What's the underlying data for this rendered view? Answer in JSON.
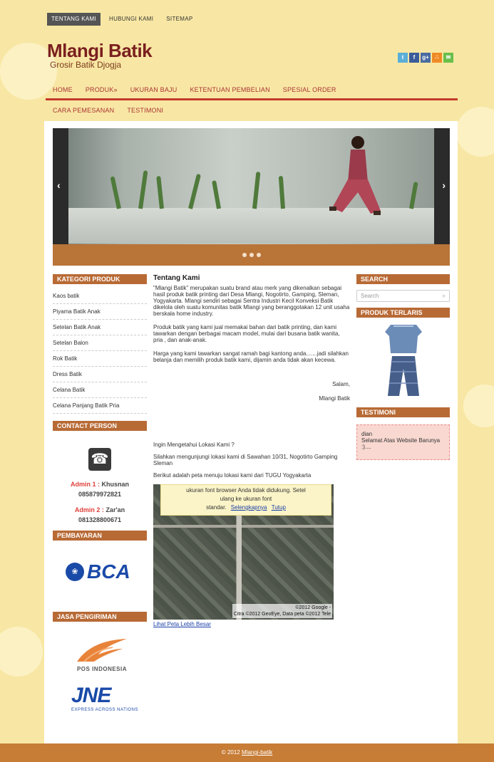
{
  "top_nav": [
    {
      "label": "TENTANG KAMI",
      "active": true
    },
    {
      "label": "HUBUNGI KAMI",
      "active": false
    },
    {
      "label": "SITEMAP",
      "active": false
    }
  ],
  "brand": {
    "title": "Mlangi Batik",
    "tagline": "Grosir Batik Djogja"
  },
  "social_icons": [
    {
      "name": "twitter-icon",
      "glyph": "t",
      "color": "#5aaed8"
    },
    {
      "name": "facebook-icon",
      "glyph": "f",
      "color": "#3b5b9a"
    },
    {
      "name": "googleplus-icon",
      "glyph": "g+",
      "color": "#4a6aa0"
    },
    {
      "name": "rss-icon",
      "glyph": "∴",
      "color": "#f08a24"
    },
    {
      "name": "email-icon",
      "glyph": "✉",
      "color": "#6abf4a"
    }
  ],
  "main_nav": {
    "row1": [
      "HOME",
      "PRODUK»",
      "UKURAN BAJU",
      "KETENTUAN PEMBELIAN",
      "SPESIAL ORDER"
    ],
    "row2": [
      "CARA PEMESANAN",
      "TESTIMONI"
    ]
  },
  "slider": {
    "prev": "‹",
    "next": "›"
  },
  "left": {
    "categories_title": "KATEGORI PRODUK",
    "categories": [
      "Kaos batik",
      "Piyama Batik Anak",
      "Setelan Batik Anak",
      "Setelan Balon",
      "Rok Batik",
      "Dress Batik",
      "Celana Batik",
      "Celana Panjang Batik Pria"
    ],
    "contact_title": "CONTACT PERSON",
    "admins": [
      {
        "label": "Admin 1 :",
        "name": "Khusnan",
        "phone": "085879972821"
      },
      {
        "label": "Admin 2 :",
        "name": "Zar'an",
        "phone": "081328800671"
      }
    ],
    "payment_title": "PEMBAYARAN",
    "bank": "BCA",
    "shipping_title": "JASA PENGIRIMAN",
    "pos": "POS INDONESIA",
    "jne": "JNE",
    "jne_sub": "EXPRESS ACROSS NATIONS"
  },
  "center": {
    "title": "Tentang Kami",
    "p1": "\"Mlangi Batik\" merupakan suatu brand atau merk yang dikenalkan sebagai hasil produk batik printing dari Desa Mlangi, Nogotirto, Gamping, Sleman, Yogyakarta. Mlangi sendiri sebagai Sentra Industri Kecil Konveksi Batik dikelola oleh suatu komunitas batik Mlangi yang beranggotakan 12 unit usaha berskala home industry.",
    "p2": "Produk batik yang kami jual memakai bahan dari batik printing, dan kami tawarkan dengan berbagai macam model, mulai dari busana batik wanita, pria , dan anak-anak.",
    "p3": "Harga yang kami tawarkan sangat ramah bagi kantong anda.......jadi silahkan belanja dan memilih produk batik kami, dijamin anda tidak akan kecewa.",
    "salam": "Salam,",
    "signer": "Mlangi Batik",
    "loc_q": "Ingin Mengetahui Lokasi Kami ?",
    "loc_1": "Silahkan mengunjungi lokasi kami di Sawahan 10/31, Nogotirto Gamping Sleman",
    "loc_2": "Berikut adalah peta menuju lokasi kami dari TUGU Yogyakarta",
    "map_notice_1": "ukuran font browser Anda tidak didukung. Setel",
    "map_notice_2": "ulang ke ukuran font",
    "map_notice_3": "standar.",
    "map_more": "Selengkapnya",
    "map_close": "Tutup",
    "map_copy_1": "©2012 Google -",
    "map_copy_2": "Citra ©2012 GeoEye, Data peta ©2012 Tele",
    "map_link": "Lihat Peta Lebih Besar"
  },
  "right": {
    "search_title": "SEARCH",
    "search_placeholder": "Search",
    "search_go": "»",
    "products_title": "PRODUK TERLARIS",
    "testimoni_title": "TESTIMONI",
    "testimoni_name": "dian",
    "testimoni_text": "Selamat Atas Website Barunya :)...."
  },
  "footer": {
    "prefix": "© 2012",
    "link": "Mlangi-batik"
  }
}
